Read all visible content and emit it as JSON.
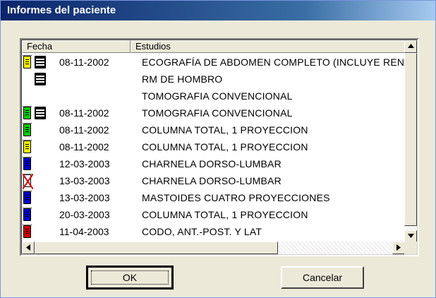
{
  "window": {
    "title": "Informes del paciente"
  },
  "list": {
    "columns": [
      "Fecha",
      "Estudios"
    ],
    "rows": [
      {
        "date": "08-11-2002",
        "study": "ECOGRAFÍA DE ABDOMEN COMPLETO (INCLUYE RENA",
        "icons": [
          "doc-yellow-icon",
          "xray-film-icon"
        ]
      },
      {
        "date": "",
        "study": "RM DE HOMBRO",
        "icons": [
          "xray-film-icon"
        ]
      },
      {
        "date": "",
        "study": "TOMOGRAFIA CONVENCIONAL",
        "icons": []
      },
      {
        "date": "08-11-2002",
        "study": "TOMOGRAFIA CONVENCIONAL",
        "icons": [
          "doc-green-icon",
          "xray-film-icon"
        ]
      },
      {
        "date": "08-11-2002",
        "study": "COLUMNA TOTAL, 1 PROYECCION",
        "icons": [
          "doc-green-icon"
        ]
      },
      {
        "date": "08-11-2002",
        "study": "COLUMNA TOTAL, 1 PROYECCION",
        "icons": [
          "doc-yellow-icon"
        ]
      },
      {
        "date": "12-03-2003",
        "study": "CHARNELA DORSO-LUMBAR",
        "icons": [
          "doc-blue-icon"
        ]
      },
      {
        "date": "13-03-2003",
        "study": "CHARNELA DORSO-LUMBAR",
        "icons": [
          "doc-cancelled-icon"
        ]
      },
      {
        "date": "13-03-2003",
        "study": "MASTOIDES CUATRO PROYECCIONES",
        "icons": [
          "doc-blue-icon"
        ]
      },
      {
        "date": "20-03-2003",
        "study": "COLUMNA TOTAL, 1 PROYECCION",
        "icons": [
          "doc-blue-icon"
        ]
      },
      {
        "date": "11-04-2003",
        "study": "CODO, ANT.-POST. Y LAT",
        "icons": [
          "doc-red-icon"
        ]
      }
    ]
  },
  "buttons": {
    "ok_label": "OK",
    "cancel_label": "Cancelar"
  },
  "colors": {
    "doc-yellow": "#f0f000",
    "doc-green": "#00c800",
    "doc-blue": "#0000c8",
    "doc-red": "#d00000",
    "doc-cancelled": "#ffffff"
  }
}
